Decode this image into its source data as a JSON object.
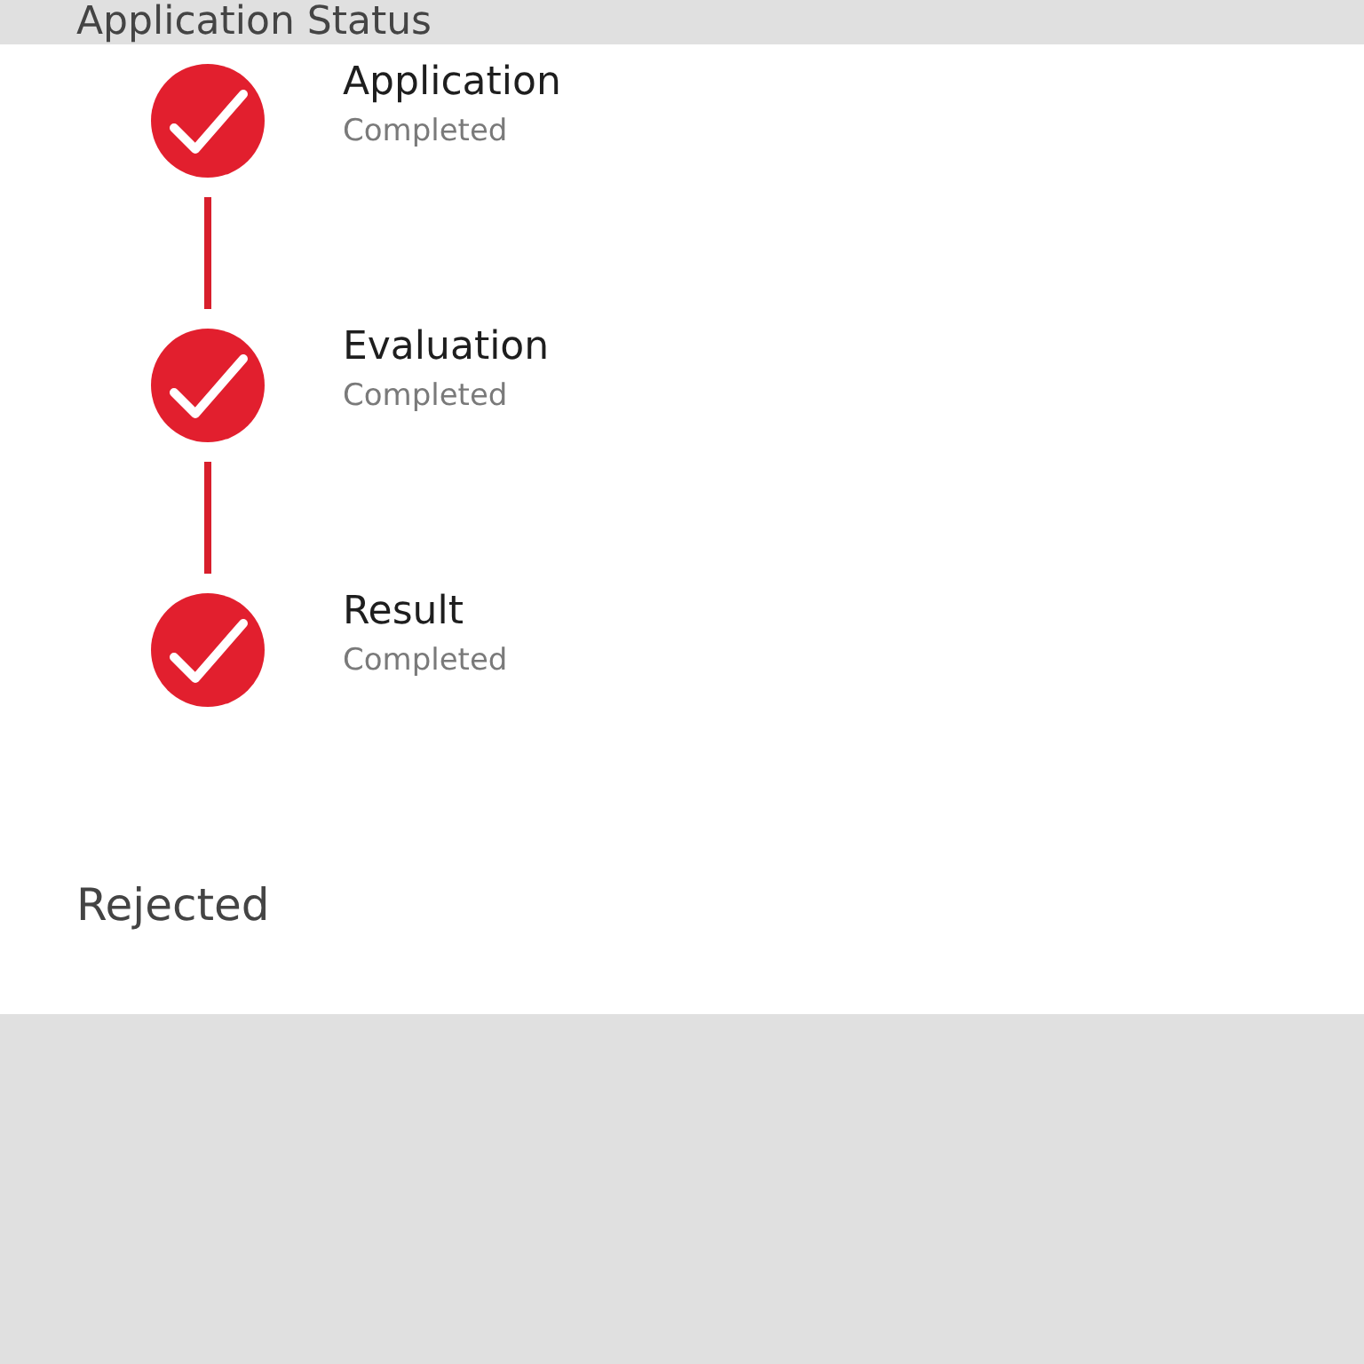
{
  "header": {
    "title": "Application Status"
  },
  "steps": [
    {
      "title": "Application",
      "status": "Completed",
      "completed": true
    },
    {
      "title": "Evaluation",
      "status": "Completed",
      "completed": true
    },
    {
      "title": "Result",
      "status": "Completed",
      "completed": true
    }
  ],
  "result": {
    "label": "Rejected"
  }
}
